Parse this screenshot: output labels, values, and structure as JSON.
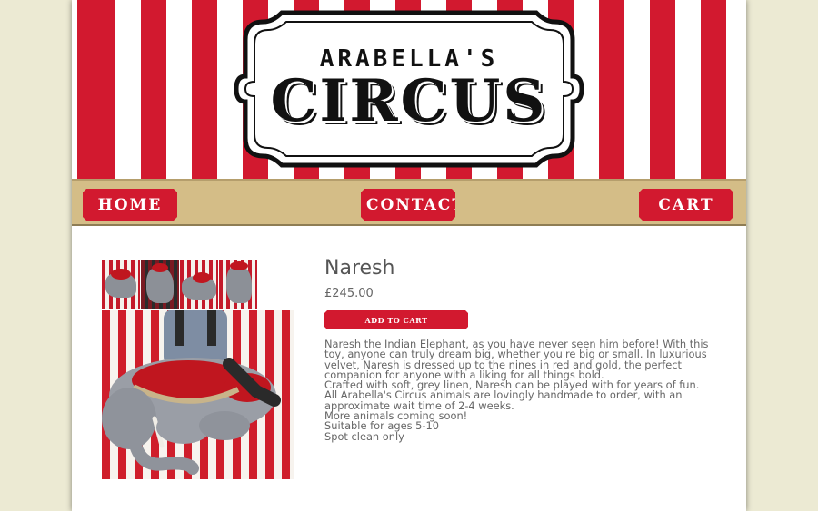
{
  "header": {
    "logo_top": "ARABELLA'S",
    "logo_main": "CIRCUS"
  },
  "nav": {
    "home": "HOME",
    "contact": "CONTACT",
    "cart": "CART"
  },
  "product": {
    "title": "Naresh",
    "price": "£245.00",
    "add_to_cart": "ADD TO CART",
    "description": [
      "Naresh the Indian Elephant, as you have never seen him before! With this toy, anyone can truly dream big, whether you're big or small. In luxurious velvet, Naresh is dressed up to the nines in red and gold, the perfect companion for anyone with a liking for all things bold.",
      "Crafted with soft, grey linen, Naresh can be played with for years of fun. All Arabella's Circus animals are lovingly handmade to order, with an approximate wait time of 2-4 weeks.",
      "More animals coming soon!",
      "Suitable for ages 5-10",
      "Spot clean only"
    ]
  },
  "colors": {
    "accent_red": "#d2192f",
    "nav_tan": "#d4bd87",
    "background": "#ecead3"
  }
}
